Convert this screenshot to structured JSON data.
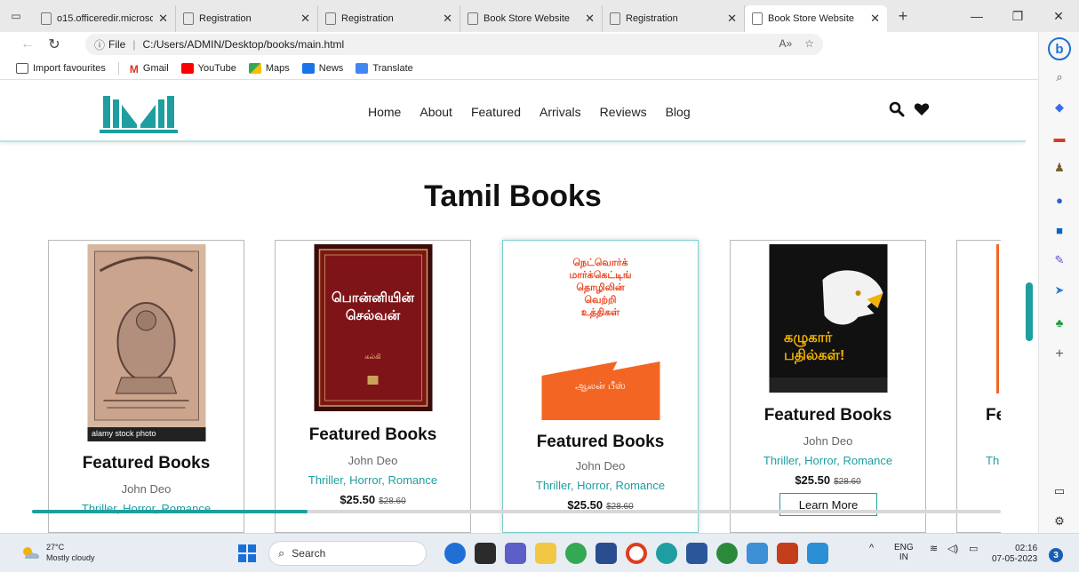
{
  "browser": {
    "tabs": [
      {
        "title": "o15.officeredir.microsc",
        "active": false
      },
      {
        "title": "Registration",
        "active": false
      },
      {
        "title": "Registration",
        "active": false
      },
      {
        "title": "Book Store Website",
        "active": false
      },
      {
        "title": "Registration",
        "active": false
      },
      {
        "title": "Book Store Website",
        "active": true
      }
    ],
    "address": {
      "scheme_label": "File",
      "url": "C:/Users/ADMIN/Desktop/books/main.html"
    },
    "bookmarks": [
      {
        "label": "Import favourites",
        "icon": "import-icon"
      },
      {
        "label": "Gmail",
        "icon": "gmail-icon",
        "color": "#d93025"
      },
      {
        "label": "YouTube",
        "icon": "youtube-icon",
        "color": "#ff0000"
      },
      {
        "label": "Maps",
        "icon": "maps-icon",
        "color": "#34a853"
      },
      {
        "label": "News",
        "icon": "news-icon",
        "color": "#1a73e8"
      },
      {
        "label": "Translate",
        "icon": "translate-icon",
        "color": "#4285f4"
      }
    ]
  },
  "site": {
    "nav": [
      "Home",
      "About",
      "Featured",
      "Arrivals",
      "Reviews",
      "Blog"
    ],
    "section_title": "Tamil Books",
    "accent": "#1e9ea0",
    "cards": [
      {
        "title": "Featured Books",
        "author": "John Deo",
        "genre": "Thriller, Horror, Romance",
        "price": "",
        "old_price": "",
        "cover_caption": "alamy stock photo"
      },
      {
        "title": "Featured Books",
        "author": "John Deo",
        "genre": "Thriller, Horror, Romance",
        "price": "$25.50",
        "old_price": "$28.60",
        "cover_title_line1": "பொன்னியின்",
        "cover_title_line2": "செல்வன்",
        "cover_author": "கல்கி"
      },
      {
        "title": "Featured Books",
        "author": "John Deo",
        "genre": "Thriller, Horror, Romance",
        "price": "$25.50",
        "old_price": "$28.60",
        "cover_lines": [
          "நெட்வொர்க்",
          "மார்க்கெட்டிங்",
          "தொழிலின்",
          "வெற்றி",
          "உத்திகள்"
        ],
        "cover_author": "ஆலன் பீஸ்"
      },
      {
        "title": "Featured Books",
        "author": "John Deo",
        "genre": "Thriller, Horror, Romance",
        "price": "$25.50",
        "old_price": "$28.60",
        "button": "Learn More",
        "cover_line1": "கழுகார்",
        "cover_line2": "பதில்கள்!"
      },
      {
        "title": "Fe",
        "author": "",
        "genre": "Th"
      }
    ]
  },
  "taskbar": {
    "weather": {
      "temp": "27°C",
      "desc": "Mostly cloudy"
    },
    "search_placeholder": "Search",
    "lang": {
      "code": "ENG",
      "region": "IN"
    },
    "clock": {
      "time": "02:16",
      "date": "07-05-2023"
    },
    "notifications": "3"
  }
}
